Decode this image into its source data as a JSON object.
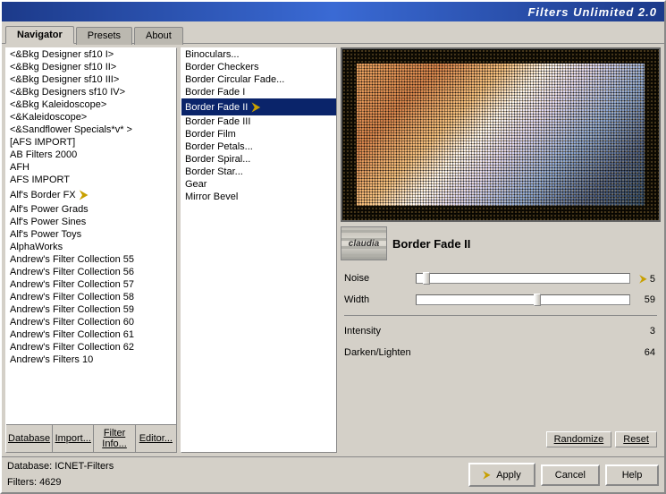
{
  "title": "Filters Unlimited 2.0",
  "tabs": [
    {
      "label": "Navigator",
      "active": true
    },
    {
      "label": "Presets",
      "active": false
    },
    {
      "label": "About",
      "active": false
    }
  ],
  "left_panel": {
    "items": [
      {
        "text": "&<Bkg Designer sf10 I>"
      },
      {
        "text": "&<Bkg Designer sf10 II>"
      },
      {
        "text": "&<Bkg Designer sf10 III>"
      },
      {
        "text": "&<Bkg Designers sf10 IV>"
      },
      {
        "text": "&<Bkg Kaleidoscope>"
      },
      {
        "text": "&<Kaleidoscope>"
      },
      {
        "text": "&<Sandflower Specials*v* >"
      },
      {
        "text": "[AFS IMPORT]"
      },
      {
        "text": "AB Filters 2000"
      },
      {
        "text": "AFH"
      },
      {
        "text": "AFS IMPORT"
      },
      {
        "text": "Alf's Border FX",
        "has_arrow": true
      },
      {
        "text": "Alf's Power Grads"
      },
      {
        "text": "Alf's Power Sines"
      },
      {
        "text": "Alf's Power Toys"
      },
      {
        "text": "AlphaWorks"
      },
      {
        "text": "Andrew's Filter Collection 55"
      },
      {
        "text": "Andrew's Filter Collection 56"
      },
      {
        "text": "Andrew's Filter Collection 57"
      },
      {
        "text": "Andrew's Filter Collection 58"
      },
      {
        "text": "Andrew's Filter Collection 59"
      },
      {
        "text": "Andrew's Filter Collection 60"
      },
      {
        "text": "Andrew's Filter Collection 61"
      },
      {
        "text": "Andrew's Filter Collection 62"
      },
      {
        "text": "Andrew's Filters 10"
      }
    ],
    "buttons": [
      {
        "label": "Database"
      },
      {
        "label": "Import..."
      },
      {
        "label": "Filter Info..."
      },
      {
        "label": "Editor..."
      }
    ]
  },
  "middle_panel": {
    "items": [
      {
        "text": "Binoculars..."
      },
      {
        "text": "Border Checkers"
      },
      {
        "text": "Border Circular Fade..."
      },
      {
        "text": "Border Fade I"
      },
      {
        "text": "Border Fade II",
        "selected": true,
        "has_arrow": true
      },
      {
        "text": "Border Fade III"
      },
      {
        "text": "Border Film"
      },
      {
        "text": "Border Petals..."
      },
      {
        "text": "Border Spiral..."
      },
      {
        "text": "Border Star..."
      },
      {
        "text": "Gear"
      },
      {
        "text": "Mirror Bevel"
      }
    ]
  },
  "preview": {
    "plugin_icon_text": "claudia",
    "filter_name": "Border Fade II"
  },
  "sliders": [
    {
      "label": "Noise",
      "value": 5,
      "percent": 3
    },
    {
      "label": "Width",
      "value": 59,
      "percent": 55
    }
  ],
  "params": [
    {
      "label": "Intensity",
      "value": 3
    },
    {
      "label": "Darken/Lighten",
      "value": 64
    }
  ],
  "action_buttons": [
    {
      "label": "Randomize"
    },
    {
      "label": "Reset"
    }
  ],
  "status": {
    "database_label": "Database:",
    "database_value": "ICNET-Filters",
    "filters_label": "Filters:",
    "filters_value": "4629"
  },
  "bottom_buttons": [
    {
      "label": "Apply"
    },
    {
      "label": "Cancel"
    },
    {
      "label": "Help"
    }
  ]
}
